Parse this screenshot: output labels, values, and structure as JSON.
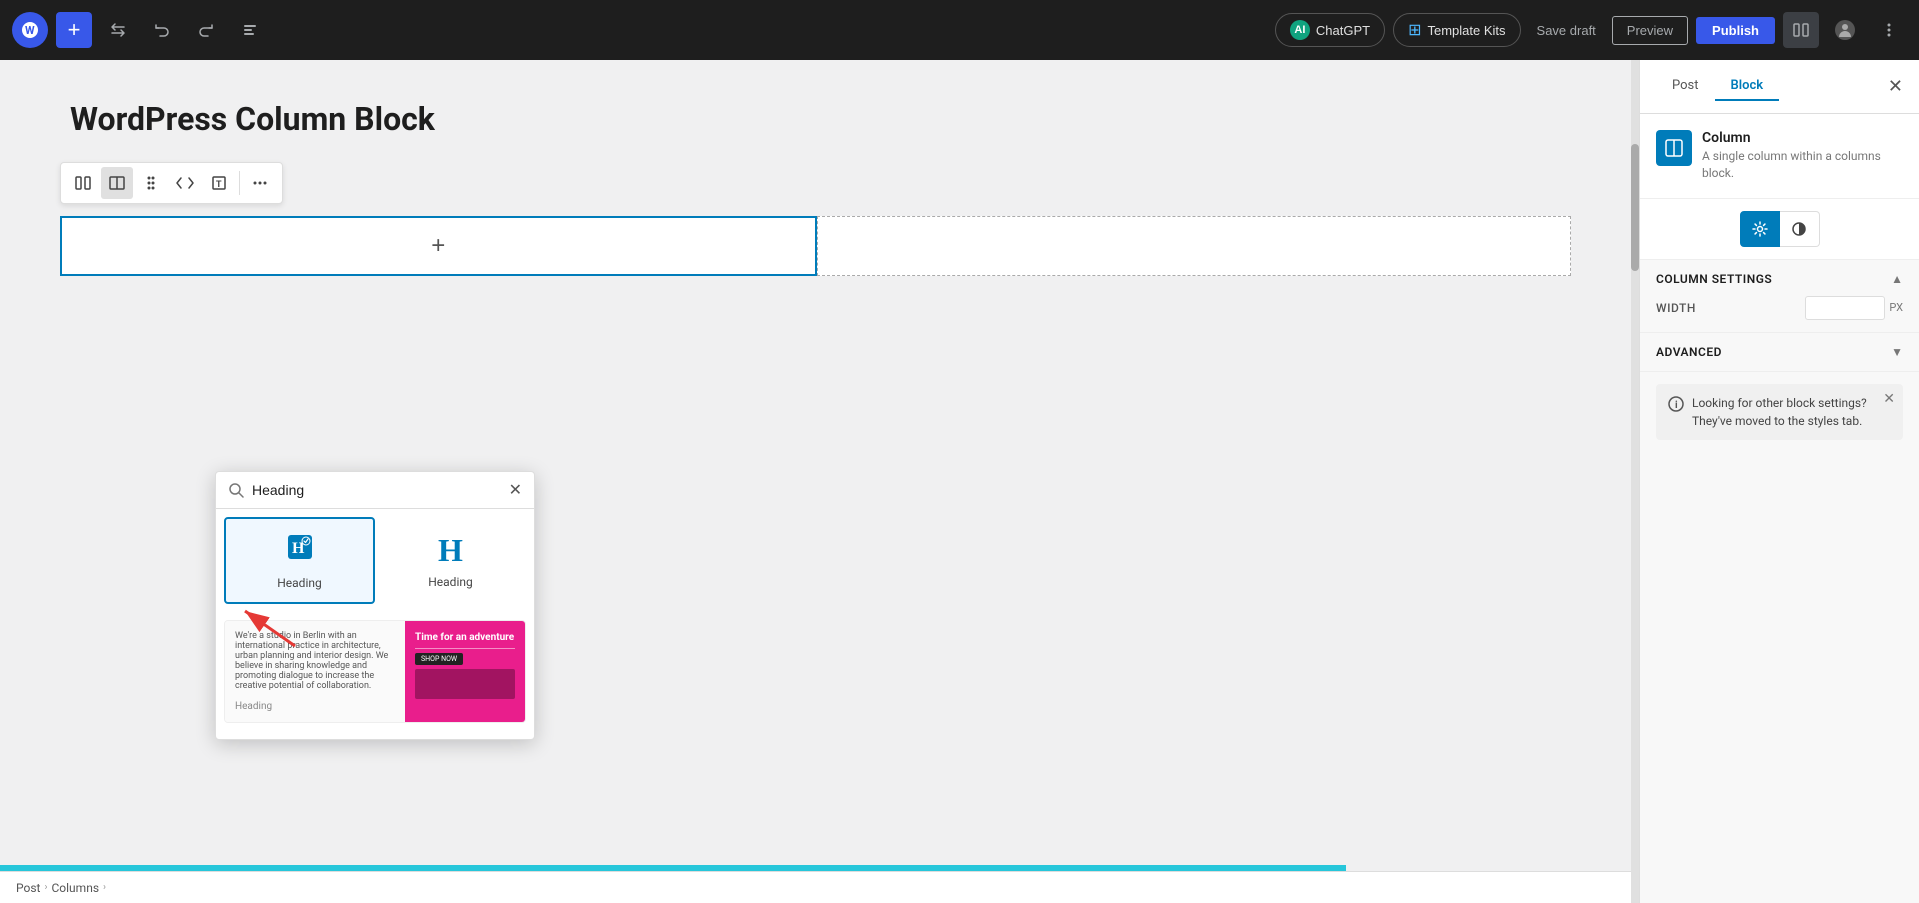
{
  "topbar": {
    "add_btn_label": "+",
    "chatgpt_label": "ChatGPT",
    "template_kits_label": "Template Kits",
    "save_draft_label": "Save draft",
    "preview_label": "Preview",
    "publish_label": "Publish"
  },
  "editor": {
    "post_title": "WordPress Column Block",
    "breadcrumb": {
      "post": "Post",
      "sep1": "›",
      "columns": "Columns",
      "sep2": "›"
    }
  },
  "block_inserter": {
    "search_placeholder": "Heading",
    "block1_label": "Heading",
    "block2_label": "Heading",
    "preview_card": {
      "left_text": "We're a studio in Berlin with an international practice in architecture, urban planning and interior design. We believe in sharing knowledge and promoting dialogue to increase the creative potential of collaboration.",
      "heading_label": "Heading",
      "right_title": "Time for an adventure",
      "right_btn": "SHOP NOW"
    }
  },
  "right_panel": {
    "tab_post": "Post",
    "tab_block": "Block",
    "block_type": "Column",
    "block_desc": "A single column within a columns block.",
    "section_column_settings": "Column settings",
    "field_width_label": "WIDTH",
    "field_width_unit": "PX",
    "section_advanced": "Advanced",
    "info_box_text": "Looking for other block settings? They've moved to the styles tab."
  }
}
